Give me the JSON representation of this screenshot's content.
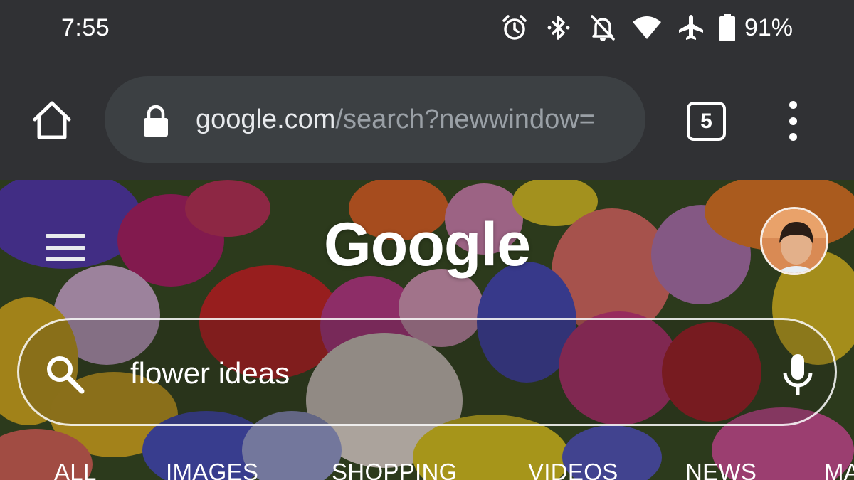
{
  "status_bar": {
    "time": "7:55",
    "battery_percent": "91%",
    "icons": [
      "alarm-icon",
      "bluetooth-icon",
      "notifications-off-icon",
      "wifi-icon",
      "airplane-mode-icon",
      "battery-icon"
    ]
  },
  "browser": {
    "url_host": "google.com",
    "url_path": "/search?newwindow=",
    "tab_count": "5",
    "icons": [
      "home-icon",
      "lock-icon",
      "tab-switcher-icon",
      "overflow-menu-icon"
    ]
  },
  "page": {
    "logo": "Google",
    "search_query": "flower ideas",
    "tabs": [
      "ALL",
      "IMAGES",
      "SHOPPING",
      "VIDEOS",
      "NEWS",
      "MA"
    ]
  },
  "colors": {
    "chrome_bar": "#303134",
    "omnibox": "#3c4043",
    "url_host": "#e8eaed",
    "url_path": "#9aa0a6"
  }
}
